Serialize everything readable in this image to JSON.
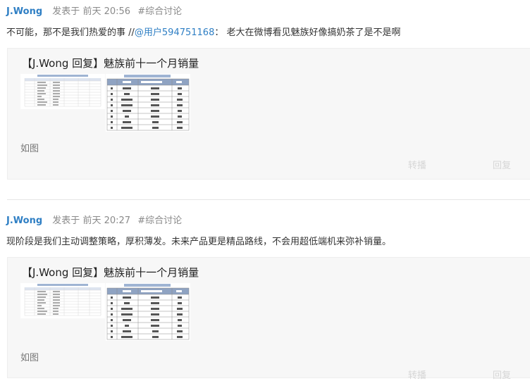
{
  "posts": [
    {
      "author": "J.Wong",
      "posted_label": "发表于",
      "time": "前天 20:56",
      "tag": "#综合讨论",
      "content_text": "不可能，那不是我们热爱的事 //",
      "mention": "@用户594751168",
      "content_tail": "： 老大在微博看见魅族好像搞奶茶了是不是啊",
      "quote_title": "【J.Wong 回复】魅族前十一个月销量",
      "quote_note": "如图",
      "repost_label": "转播",
      "reply_label": "回复"
    },
    {
      "author": "J.Wong",
      "posted_label": "发表于",
      "time": "前天 20:27",
      "tag": "#综合讨论",
      "content_text": "现阶段是我们主动调整策略，厚积薄发。未来产品更是精品路线，不会用超低端机来弥补销量。",
      "quote_title": "【J.Wong 回复】魅族前十一个月销量",
      "quote_note": "如图",
      "repost_label": "转播",
      "reply_label": "回复"
    }
  ],
  "sales_table": {
    "brands": [
      "OPPO",
      "vivo",
      "HUAWEI",
      "HONOR",
      "Apple",
      "MI",
      "Meizu",
      "Samsung",
      "Gionee"
    ],
    "values": [
      "7106",
      "6862",
      "5867",
      "4962",
      "4513",
      "4105",
      "967",
      "565",
      "467"
    ],
    "changes": [
      "-1%",
      "-3%",
      "-18%",
      "-11%",
      "-1%",
      "3%",
      "-91%",
      "-39%",
      "-61%"
    ]
  }
}
